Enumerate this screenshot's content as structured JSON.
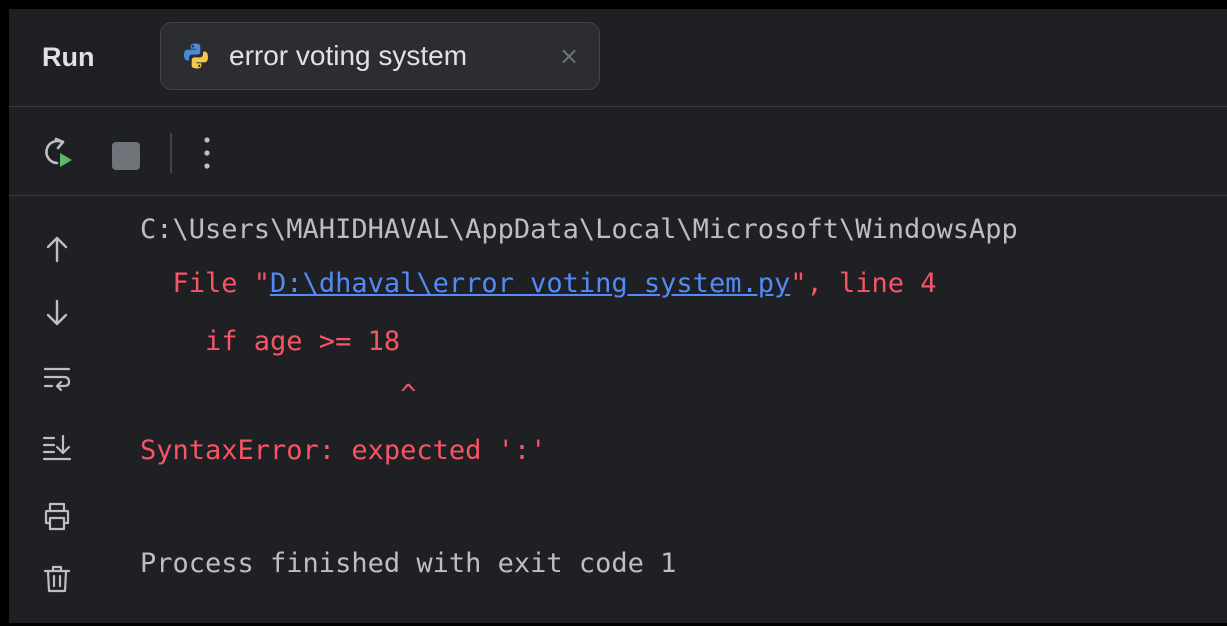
{
  "header": {
    "run_label": "Run",
    "tab": {
      "label": "error voting system",
      "icon": "python-icon",
      "close_glyph": "×"
    }
  },
  "toolbar": {
    "buttons": [
      "rerun-icon",
      "stop-icon",
      "more-options-icon"
    ]
  },
  "gutter": {
    "icons": [
      "arrow-up-icon",
      "arrow-down-icon",
      "soft-wrap-icon",
      "scroll-to-end-icon",
      "print-icon",
      "trash-icon"
    ]
  },
  "console": {
    "path_line": "C:\\Users\\MAHIDHAVAL\\AppData\\Local\\Microsoft\\WindowsApp",
    "file_prefix": "  File \"",
    "file_link": "D:\\dhaval\\error voting system.py",
    "file_suffix": "\", line 4",
    "code_line": "    if age >= 18",
    "caret_line": "                ^",
    "error_line": "SyntaxError: expected ':'",
    "finished_line": "Process finished with exit code 1"
  },
  "colors": {
    "background": "#1f2023",
    "text": "#bcbec4",
    "error": "#f75464",
    "link": "#548af7"
  }
}
